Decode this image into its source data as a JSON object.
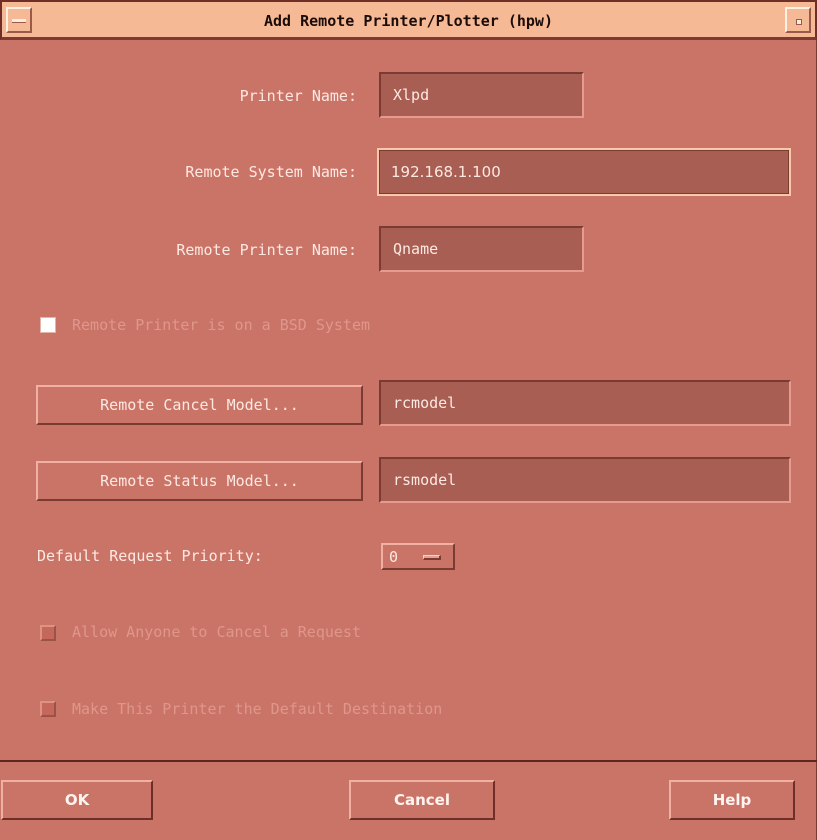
{
  "window": {
    "title": "Add Remote Printer/Plotter (hpw)"
  },
  "form": {
    "printer_name": {
      "label": "Printer Name:",
      "value": "Xlpd"
    },
    "remote_system_name": {
      "label": "Remote System Name:",
      "value": "192.168.1.100"
    },
    "remote_printer_name": {
      "label": "Remote Printer Name:",
      "value": "Qname"
    },
    "bsd_checkbox": {
      "label": "Remote Printer is on a BSD System",
      "checked": true,
      "enabled": false
    },
    "remote_cancel_model": {
      "button_label": "Remote Cancel Model...",
      "value": "rcmodel"
    },
    "remote_status_model": {
      "button_label": "Remote Status Model...",
      "value": "rsmodel"
    },
    "priority": {
      "label": "Default Request Priority:",
      "value": "0"
    },
    "allow_cancel_checkbox": {
      "label": "Allow Anyone to Cancel a Request",
      "checked": false,
      "enabled": false
    },
    "default_dest_checkbox": {
      "label": "Make This Printer the Default Destination",
      "checked": false,
      "enabled": false
    }
  },
  "buttons": {
    "ok": "OK",
    "cancel": "Cancel",
    "help": "Help"
  },
  "colors": {
    "background": "#ca7468",
    "titlebar": "#f6b995",
    "field": "#a95e53",
    "text": "#fde9e2",
    "disabled_text": "#e0968a"
  }
}
